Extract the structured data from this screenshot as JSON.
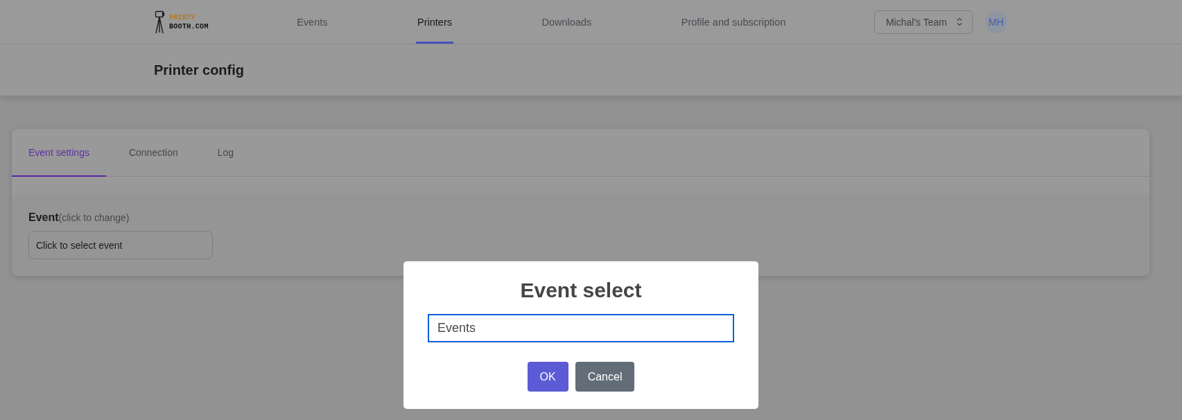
{
  "header": {
    "logo": {
      "line_1": "PRINTY",
      "line_2": "BOOTH.COM"
    },
    "nav": [
      {
        "label": "Events",
        "selected": false
      },
      {
        "label": "Printers",
        "selected": true
      },
      {
        "label": "Downloads",
        "selected": false
      },
      {
        "label": "Profile and subscription",
        "selected": false
      }
    ],
    "team_select": {
      "value": "Michal's Team"
    },
    "avatar": {
      "initials": "MH"
    }
  },
  "page_title": "Printer config",
  "card": {
    "tabs": [
      {
        "label": "Event settings",
        "selected": true
      },
      {
        "label": "Connection",
        "selected": false
      },
      {
        "label": "Log",
        "selected": false
      }
    ],
    "event_field": {
      "label": "Event",
      "hint": "(click to change)",
      "value": "Click to select event"
    }
  },
  "dialog": {
    "title": "Event select",
    "input": {
      "value": "Events",
      "focused": true
    },
    "buttons": [
      {
        "label": "OK",
        "kind": "primary"
      },
      {
        "label": "Cancel",
        "kind": "secondary"
      }
    ]
  }
}
